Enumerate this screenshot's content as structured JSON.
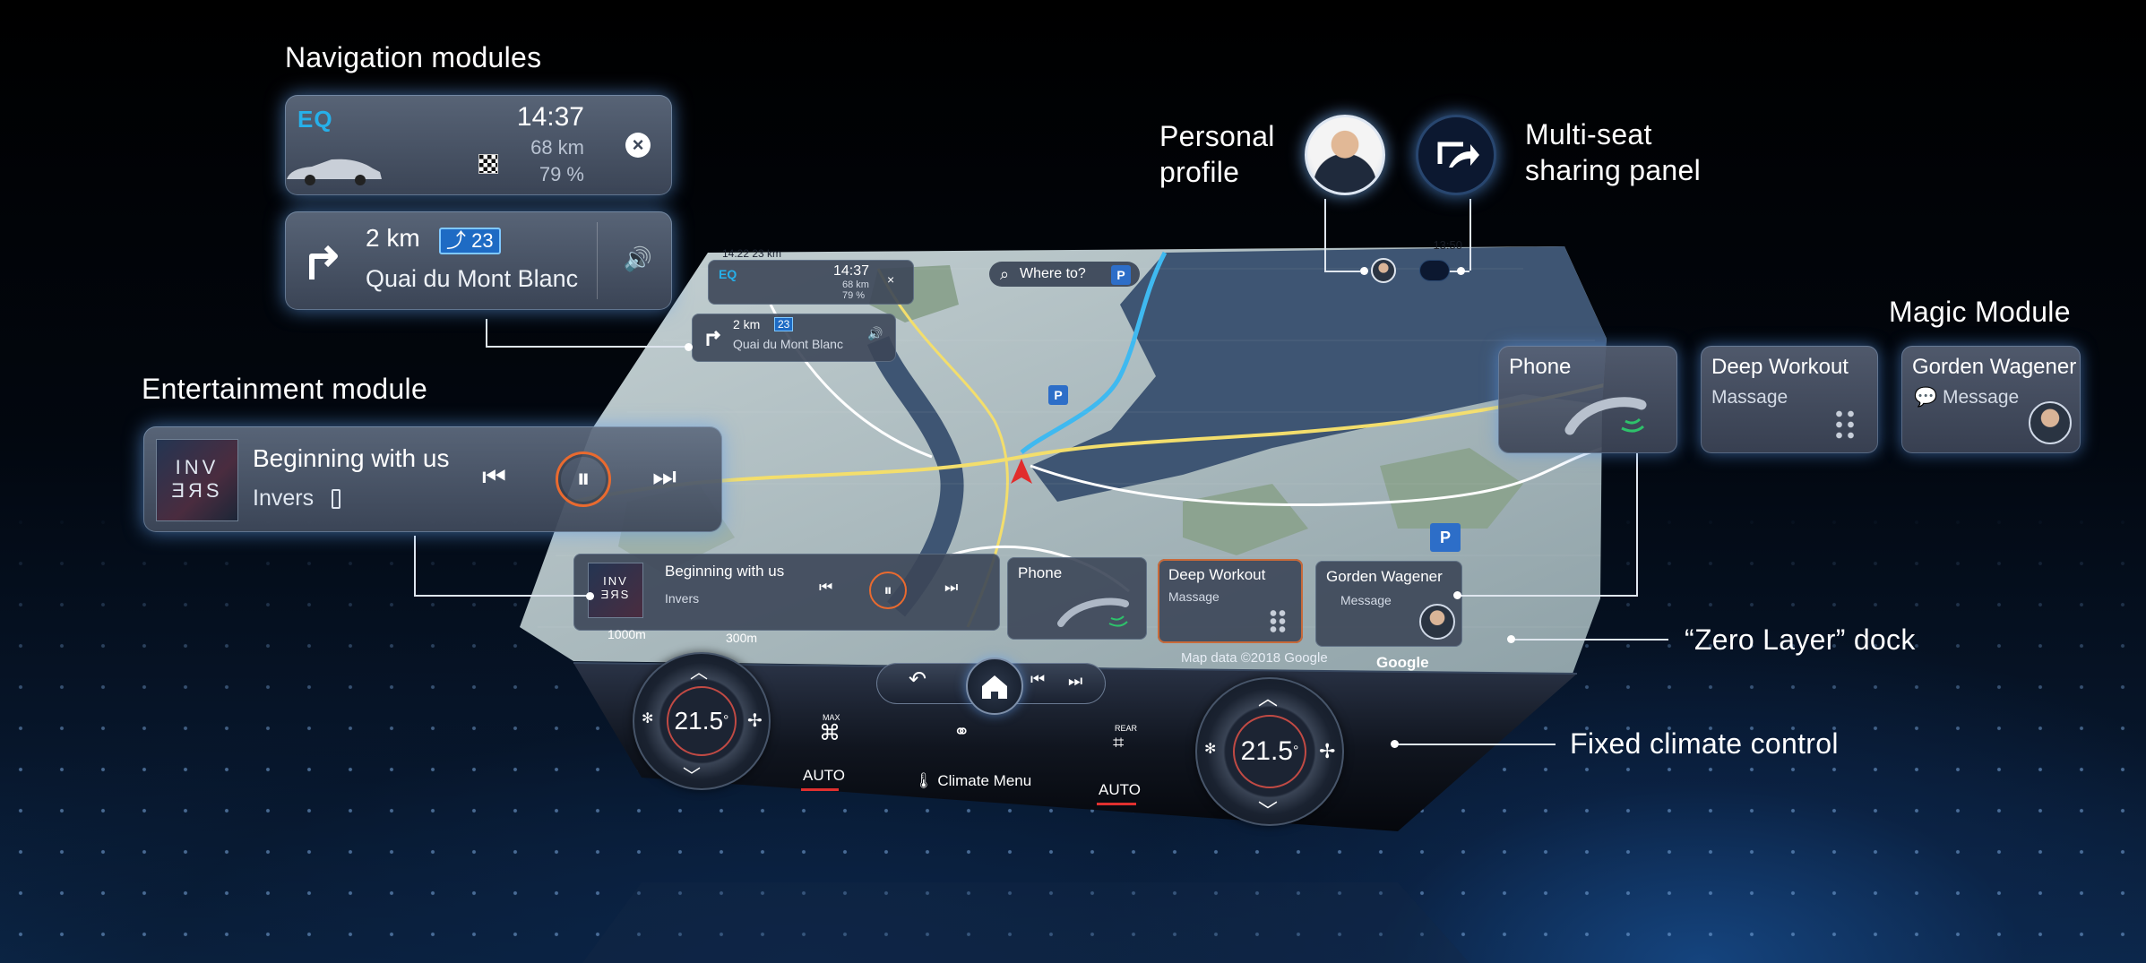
{
  "callouts": {
    "navigation": "Navigation modules",
    "entertainment": "Entertainment module",
    "profile_line1": "Personal",
    "profile_line2": "profile",
    "sharing_line1": "Multi-seat",
    "sharing_line2": "sharing panel",
    "magic": "Magic Module",
    "zero_layer": "“Zero Layer” dock",
    "climate": "Fixed climate control"
  },
  "nav_module": {
    "logo": "EQ",
    "time": "14:37",
    "range": "68 km",
    "battery": "79 %",
    "close_glyph": "×"
  },
  "route_module": {
    "distance": "2 km",
    "badge": "23",
    "street": "Quai du Mont Blanc",
    "speaker_glyph": "🔊"
  },
  "entertainment": {
    "cover_line1": "INV",
    "cover_line2": "ƎЯS",
    "title": "Beginning with us",
    "artist": "Invers",
    "prev_glyph": "⏮",
    "pause_glyph": "⏸",
    "next_glyph": "⏭"
  },
  "magic": {
    "phone_title": "Phone",
    "workout_title": "Deep Workout",
    "workout_sub": "Massage",
    "contact_title": "Gorden Wagener",
    "contact_sub": "Message"
  },
  "screen": {
    "status_left": "14:22  23 km",
    "status_time": "13:50",
    "where_to": "Where to?",
    "parking": "P",
    "map_copyright": "Map data ©2018 Google",
    "google": "Google",
    "scale_a": "1000m",
    "scale_b": "300m",
    "mini_time": "14:37",
    "mini_range": "68 km",
    "mini_pct": "79 %",
    "mini_distance": "2 km",
    "mini_badge": "23",
    "mini_street": "Quai du Mont Blanc",
    "mini_song": "Beginning with us",
    "mini_artist": "Invers",
    "mini_phone": "Phone",
    "mini_workout": "Deep Workout",
    "mini_workout_sub": "Massage",
    "mini_contact": "Gorden Wagener",
    "mini_contact_sub": "Message"
  },
  "climate": {
    "left_temp": "21.5",
    "right_temp": "21.5",
    "degree": "°",
    "left_auto": "AUTO",
    "right_auto": "AUTO",
    "menu": "Climate Menu",
    "max_label": "MAX",
    "rear_label": "REAR"
  },
  "colors": {
    "accent_glow": "#62a0eb",
    "eq_blue": "#26b0ea",
    "play_orange": "#e96a2f",
    "auto_red": "#e0302f",
    "map_water": "#3e5573",
    "map_land": "#b6c4c5"
  },
  "icons": [
    "car-icon",
    "checkered-flag-icon",
    "close-icon",
    "turn-right-icon",
    "speaker-icon",
    "previous-track-icon",
    "pause-icon",
    "next-track-icon",
    "phone-handset-icon",
    "grid-dots-icon",
    "message-icon",
    "share-seat-icon",
    "home-icon",
    "back-icon",
    "fan-icon",
    "defrost-icon",
    "search-icon"
  ]
}
